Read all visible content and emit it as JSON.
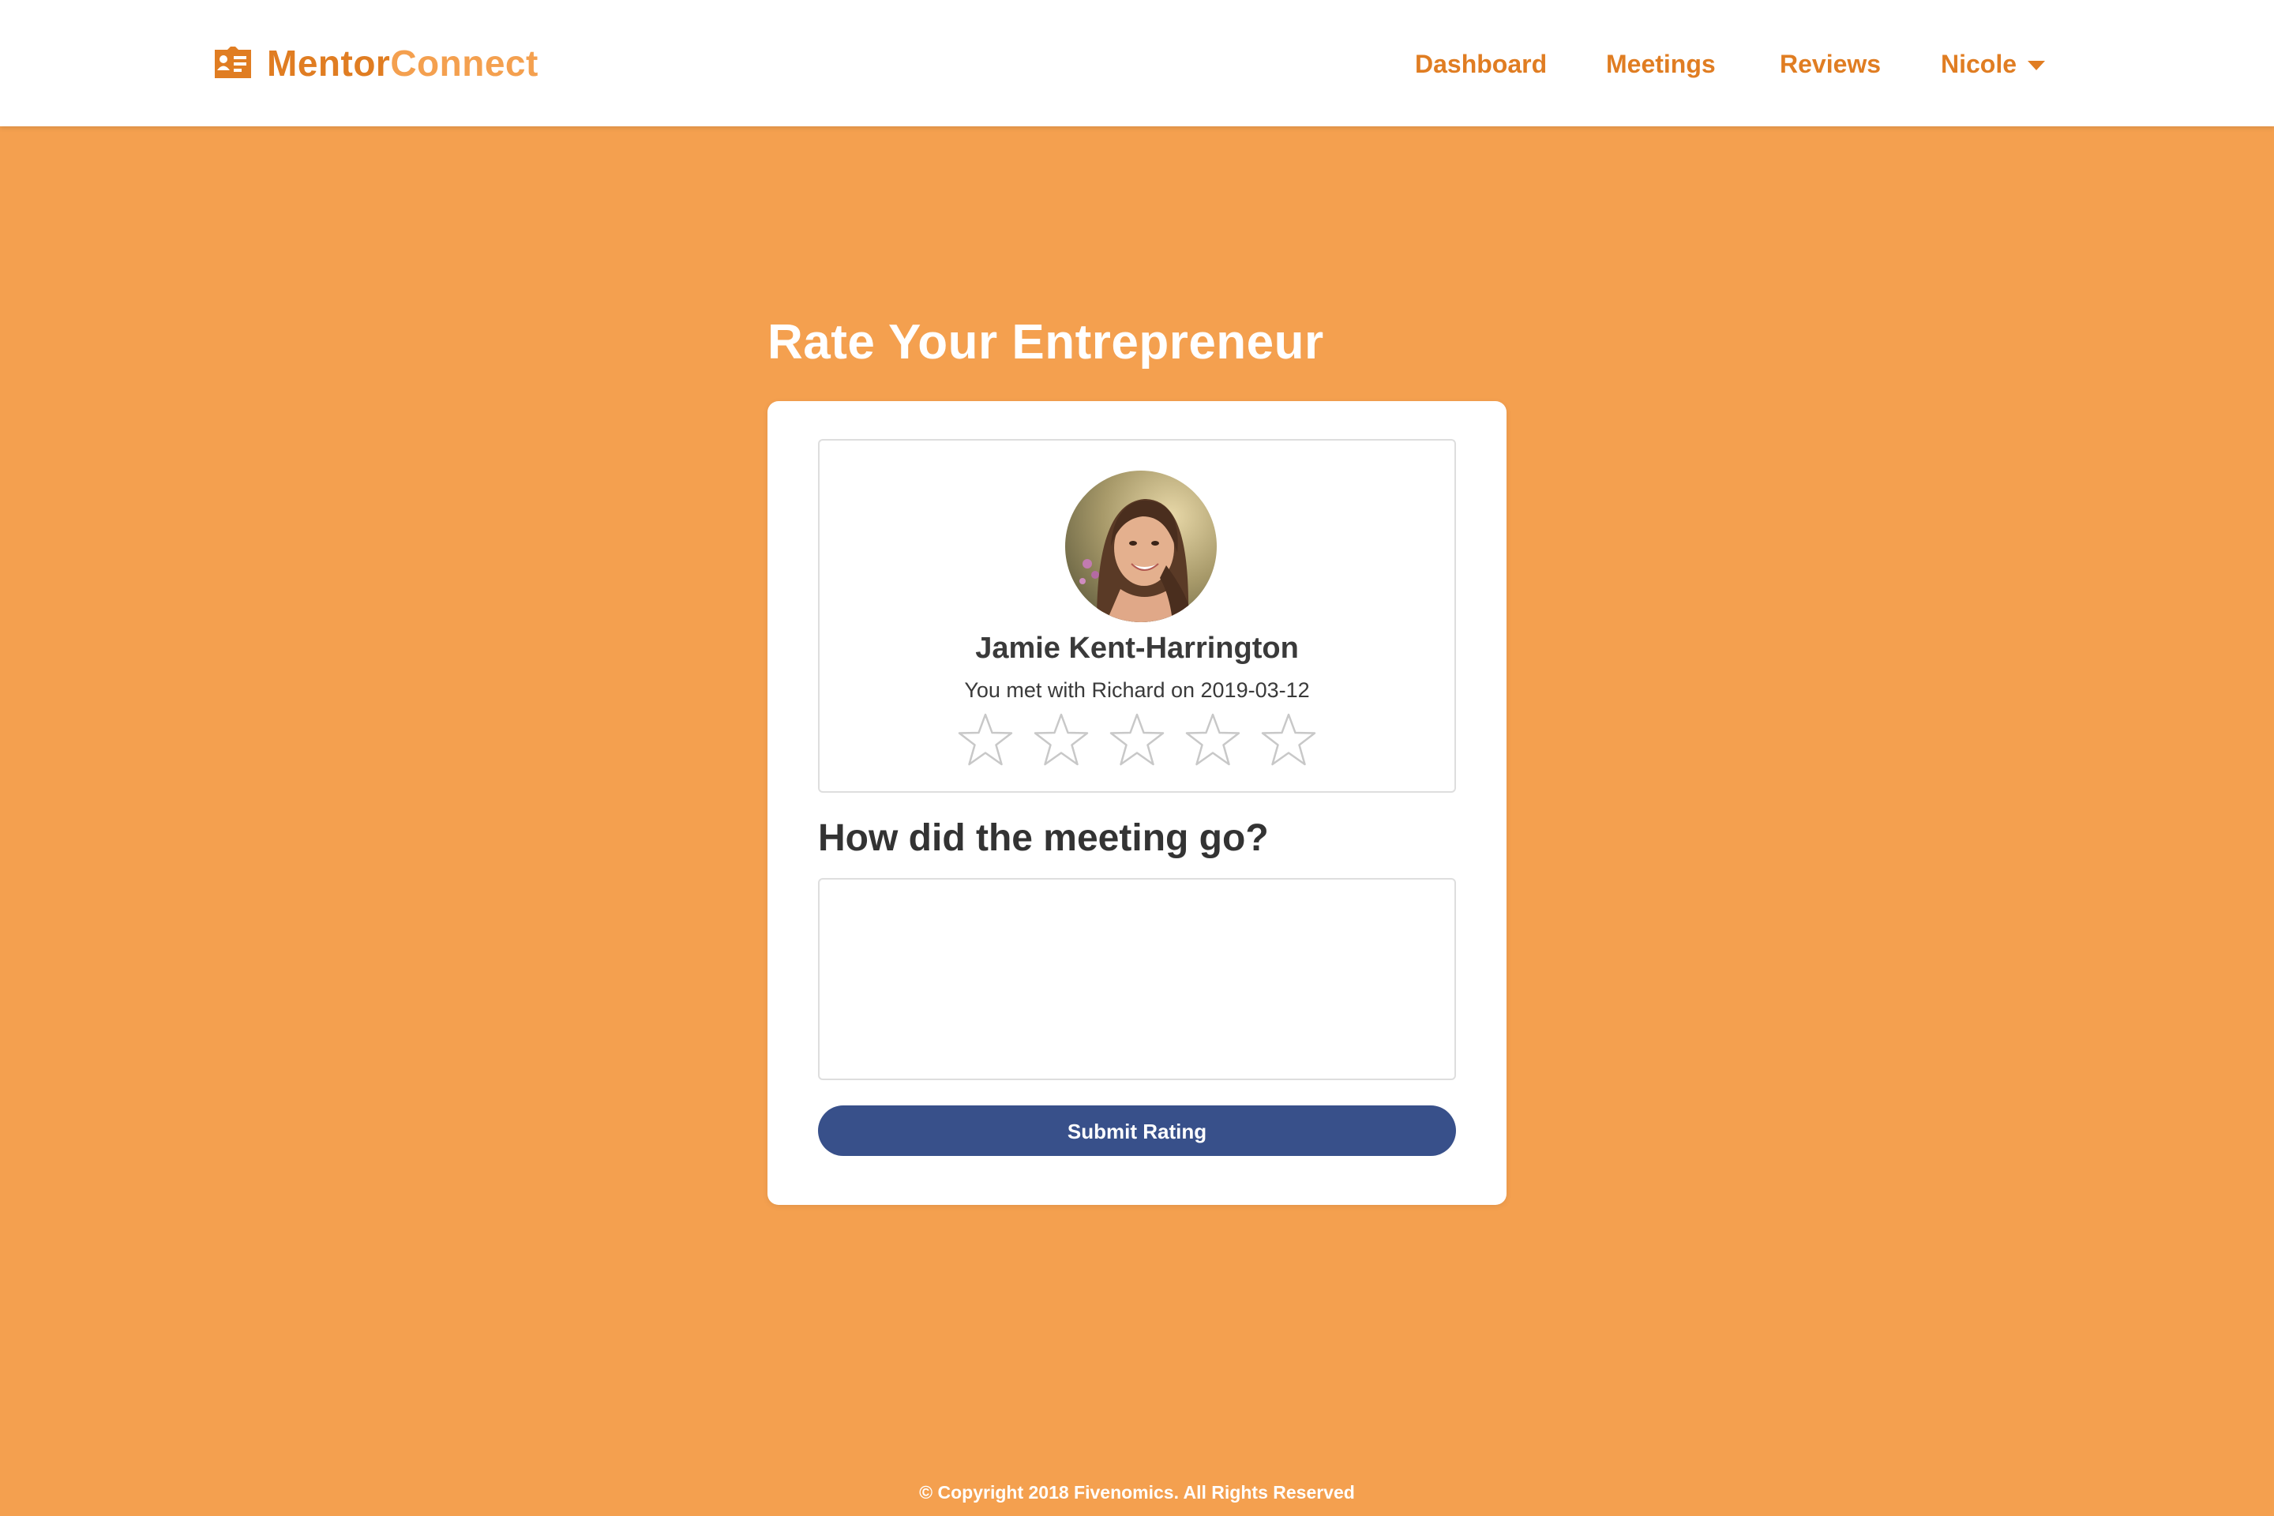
{
  "brand": {
    "name_part1": "Mentor",
    "name_part2": "Connect",
    "icon": "id-card-icon",
    "color_primary": "#e07d22",
    "color_secondary": "#f4a04f"
  },
  "nav": {
    "items": [
      {
        "label": "Dashboard"
      },
      {
        "label": "Meetings"
      },
      {
        "label": "Reviews"
      }
    ],
    "user": {
      "label": "Nicole",
      "icon": "caret-down-icon"
    }
  },
  "page": {
    "title": "Rate Your Entrepreneur",
    "background_color": "#f4a04f"
  },
  "profile": {
    "name": "Jamie Kent-Harrington",
    "meeting_info": "You met with Richard on 2019-03-12",
    "rating": {
      "value": 0,
      "max": 5,
      "icon": "star-outline-icon"
    }
  },
  "feedback": {
    "question": "How did the meeting go?",
    "value": "",
    "placeholder": ""
  },
  "submit": {
    "label": "Submit Rating",
    "color": "#38508a"
  },
  "footer": {
    "text": "© Copyright 2018 Fivenomics. All Rights Reserved"
  }
}
